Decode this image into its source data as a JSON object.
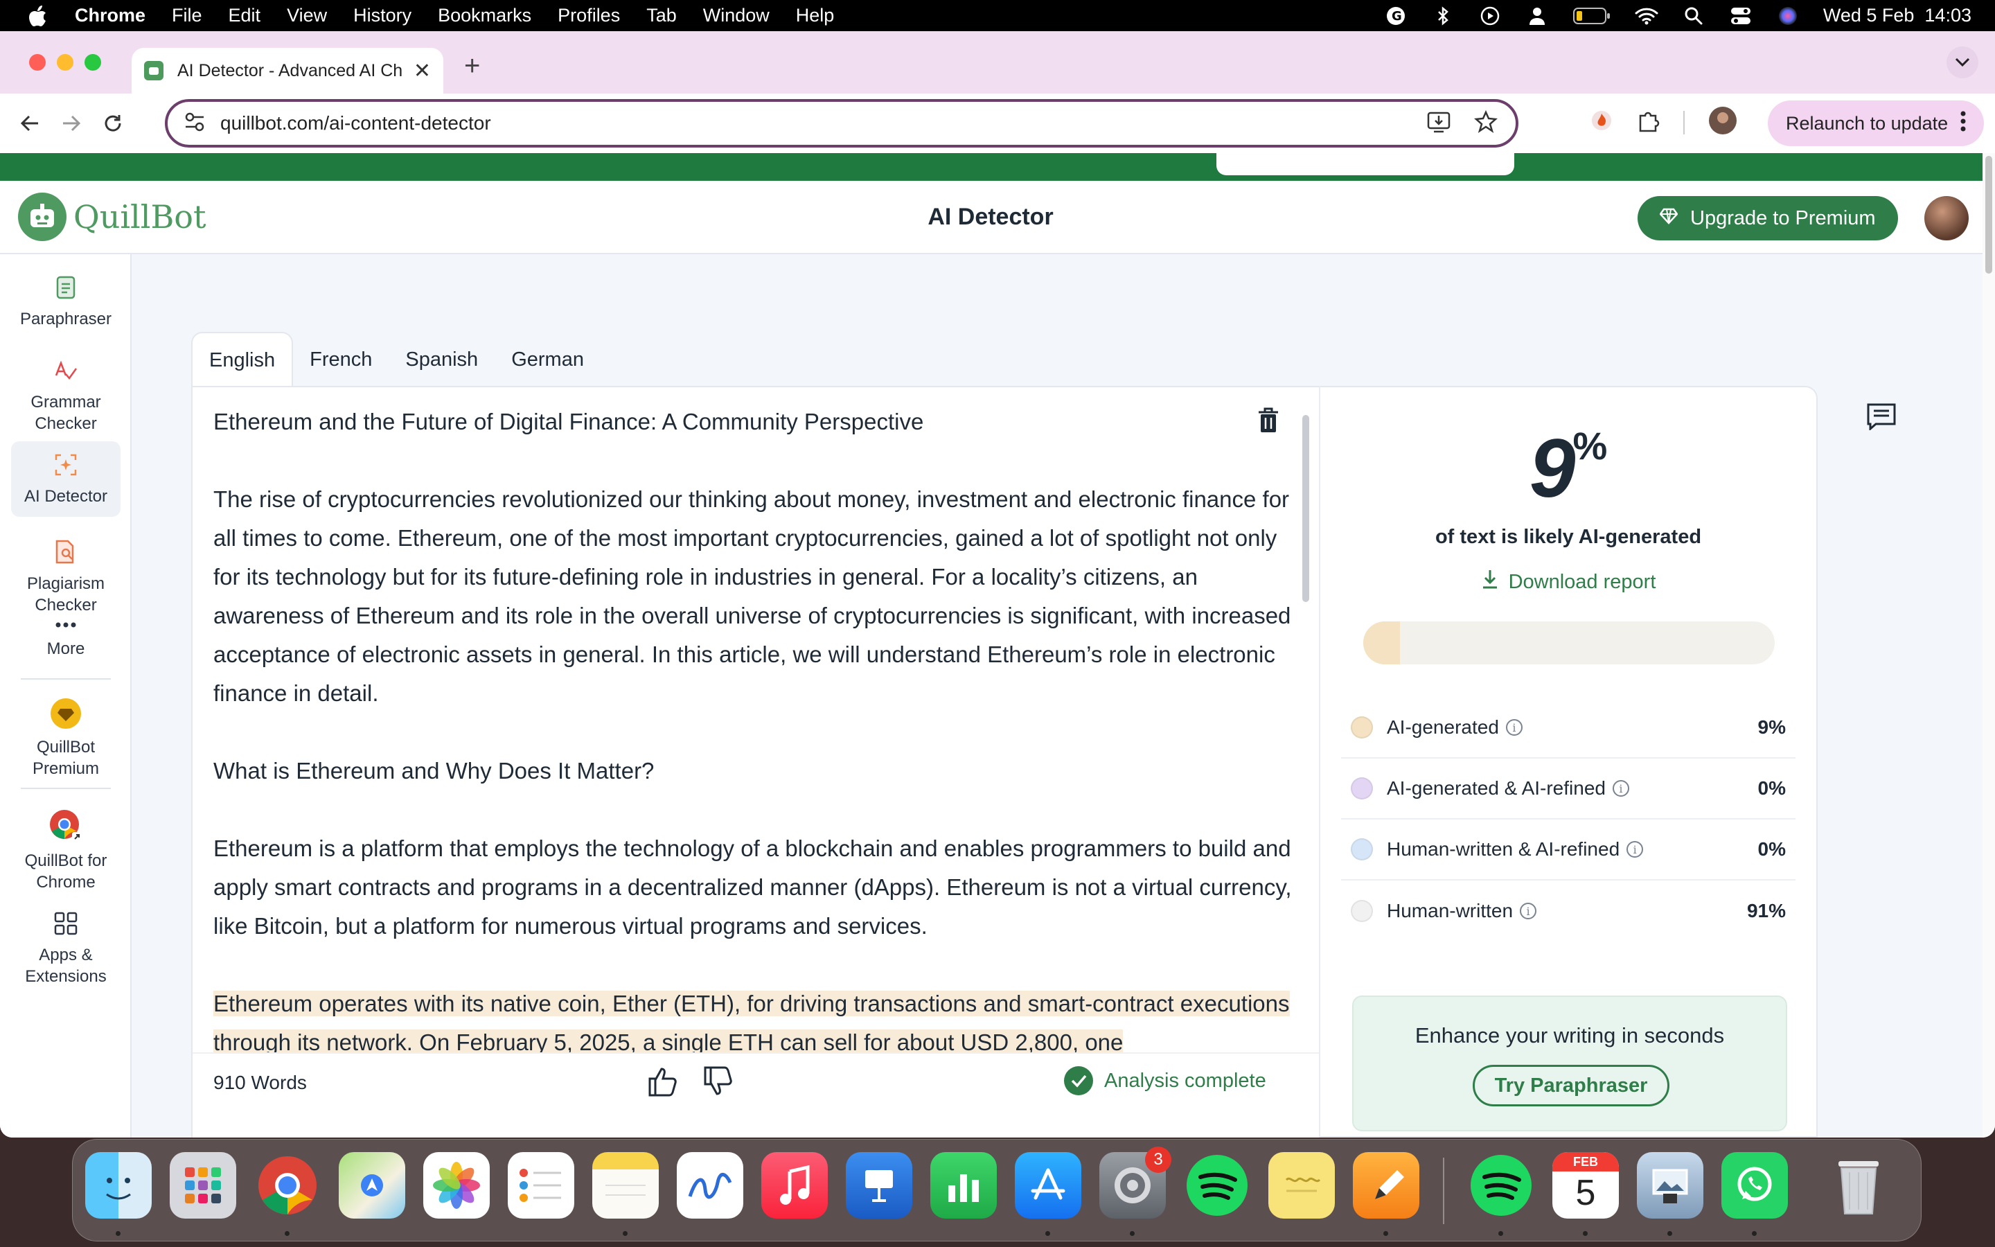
{
  "menubar": {
    "app_name": "Chrome",
    "items": [
      "File",
      "Edit",
      "View",
      "History",
      "Bookmarks",
      "Profiles",
      "Tab",
      "Window",
      "Help"
    ],
    "clock": "Wed 5 Feb  14:03"
  },
  "browser": {
    "tab_title": "AI Detector - Advanced AI Ch",
    "url_host": "quillbot.com",
    "url_path": "/ai-content-detector",
    "relaunch_label": "Relaunch to update"
  },
  "header": {
    "logo_text": "QuillBot",
    "page_title": "AI Detector",
    "upgrade_label": "Upgrade to Premium"
  },
  "sidebar": {
    "items": [
      {
        "label": "Paraphraser",
        "icon": "paraphraser-icon"
      },
      {
        "label": "Grammar Checker",
        "icon": "grammar-checker-icon"
      },
      {
        "label": "AI Detector",
        "icon": "ai-detector-icon"
      },
      {
        "label": "Plagiarism Checker",
        "icon": "plagiarism-checker-icon"
      },
      {
        "label": "More",
        "icon": "more-dots-icon"
      },
      {
        "label": "QuillBot Premium",
        "icon": "premium-diamond-icon"
      },
      {
        "label": "QuillBot for Chrome",
        "icon": "chrome-extension-icon"
      },
      {
        "label": "Apps & Extensions",
        "icon": "apps-grid-icon"
      }
    ]
  },
  "languages": [
    "English",
    "French",
    "Spanish",
    "German"
  ],
  "document": {
    "title": "Ethereum and the Future of Digital Finance: A Community Perspective",
    "p1": "The rise of cryptocurrencies revolutionized our thinking about money, investment and electronic finance for all times to come. Ethereum, one of the most important cryptocurrencies, gained a lot of spotlight not only for its technology but for its future-defining role in industries in general. For a locality’s citizens, an awareness of Ethereum and its role in the overall universe of cryptocurrencies is significant, with increased acceptance of electronic assets in general. In this article, we will understand Ethereum’s role in electronic finance in detail.",
    "h2": "What is Ethereum and Why Does It Matter?",
    "p2": "Ethereum is a platform that employs the technology of a blockchain and enables programmers to build and apply smart contracts and programs in a decentralized manner (dApps). Ethereum is not a virtual currency, like Bitcoin, but a platform for numerous virtual programs and services.",
    "p3": "Ethereum operates with its native coin, Ether (ETH), for driving transactions and smart-contract executions through its network. On February 5, 2025, a single ETH can sell for about USD 2,800, one"
  },
  "footer": {
    "word_count": "910 Words",
    "status": "Analysis complete"
  },
  "results": {
    "percent_value": "9",
    "percent_symbol": "%",
    "caption": "of text is likely AI-generated",
    "download_label": "Download report",
    "ai_fraction": 0.09,
    "legend": [
      {
        "label": "AI-generated",
        "value": "9%",
        "color": "#f4e2c2"
      },
      {
        "label": "AI-generated & AI-refined",
        "value": "0%",
        "color": "#e3d6f5"
      },
      {
        "label": "Human-written & AI-refined",
        "value": "0%",
        "color": "#d6e6f8"
      },
      {
        "label": "Human-written",
        "value": "91%",
        "color": "#f1f1f1"
      }
    ],
    "promo_text": "Enhance your writing in seconds",
    "promo_button": "Try Paraphraser"
  },
  "dock": {
    "apps": [
      "Finder",
      "Launchpad",
      "Chrome",
      "Maps",
      "Photos",
      "Reminders",
      "Notes",
      "Freeform",
      "Music",
      "Keynote",
      "Numbers",
      "App Store",
      "System Settings",
      "Spotify",
      "Stickies",
      "Pages",
      "Spotify",
      "Calendar",
      "Preview",
      "WhatsApp",
      "Trash"
    ],
    "settings_badge": "3",
    "calendar_month": "FEB",
    "calendar_day": "5"
  }
}
